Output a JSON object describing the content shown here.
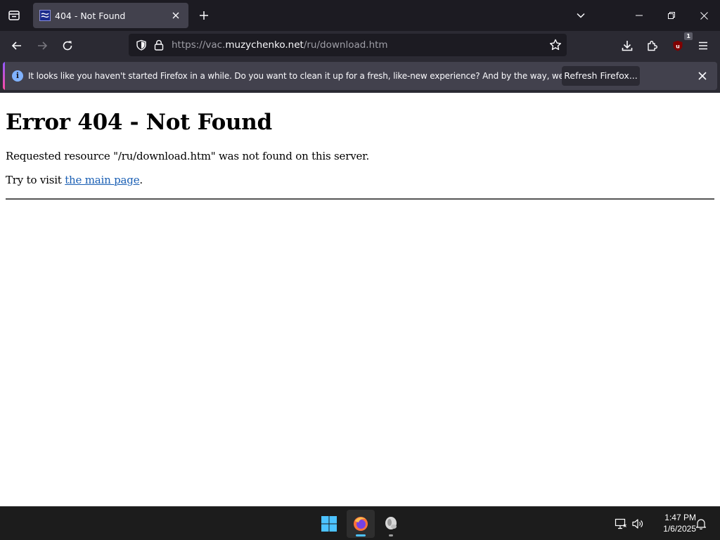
{
  "tab": {
    "title": "404 - Not Found"
  },
  "urlbar": {
    "url_prefix": "https://vac.",
    "url_domain": "muzychenko.net",
    "url_path": "/ru/download.htm"
  },
  "extensions": {
    "ublock_badge": "1"
  },
  "notification": {
    "message": "It looks like you haven't started Firefox in a while. Do you want to clean it up for a fresh, like-new experience? And by the way, welcome back!",
    "button_label": "Refresh Firefox..."
  },
  "page": {
    "heading": "Error 404 - Not Found",
    "requested_text": "Requested resource \"/ru/download.htm\" was not found on this server.",
    "try_prefix": "Try to visit ",
    "link_text": "the main page",
    "try_suffix": "."
  },
  "taskbar": {
    "time": "1:47 PM",
    "date": "1/6/2025"
  },
  "colors": {
    "chrome_dark": "#1c1b22",
    "toolbar": "#2b2a33",
    "tab_active": "#42414d",
    "link": "#1a5fb4"
  }
}
